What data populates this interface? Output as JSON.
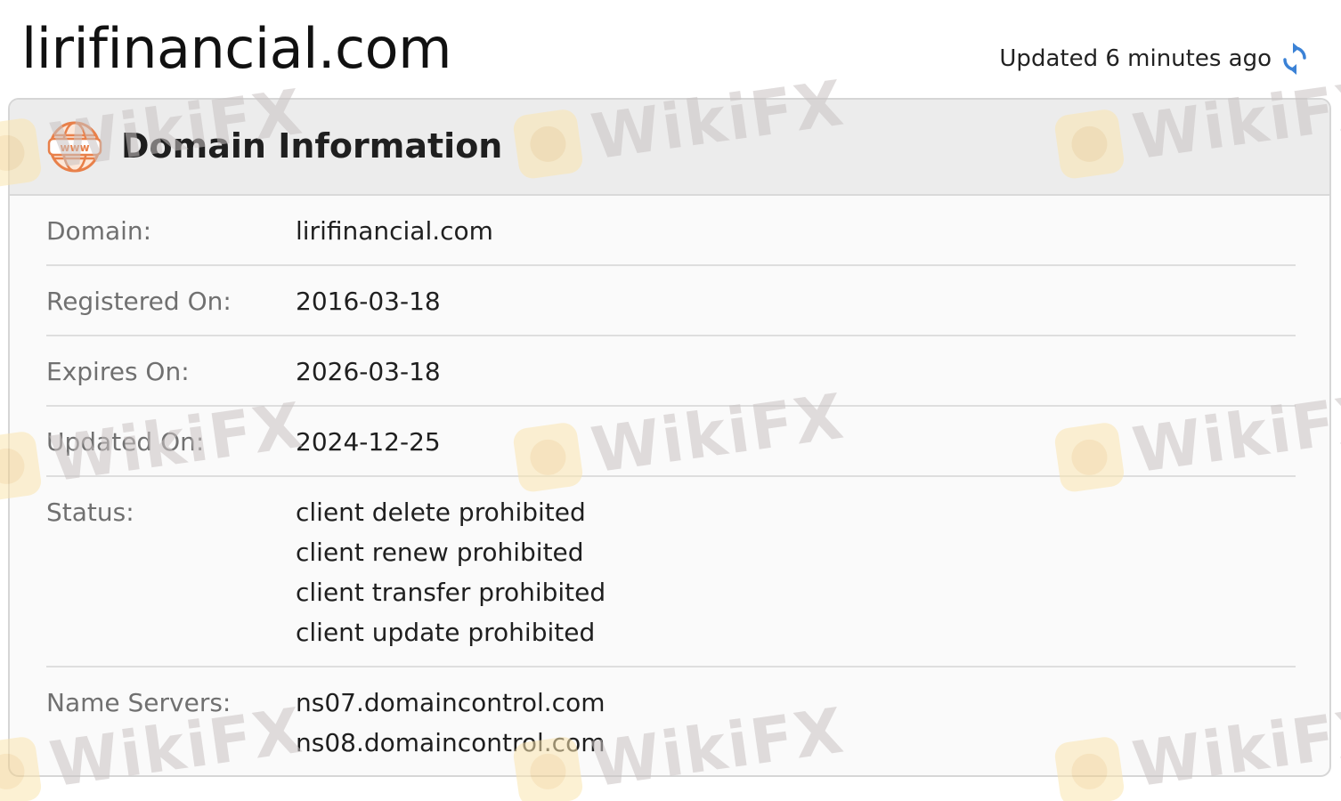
{
  "header": {
    "site_title": "lirifinancial.com",
    "updated_text": "Updated 6 minutes ago"
  },
  "card": {
    "title": "Domain Information",
    "icon": "www-icon",
    "rows": [
      {
        "label": "Domain:",
        "values": [
          "lirifinancial.com"
        ]
      },
      {
        "label": "Registered On:",
        "values": [
          "2016-03-18"
        ]
      },
      {
        "label": "Expires On:",
        "values": [
          "2026-03-18"
        ]
      },
      {
        "label": "Updated On:",
        "values": [
          "2024-12-25"
        ]
      },
      {
        "label": "Status:",
        "values": [
          "client delete prohibited",
          "client renew prohibited",
          "client transfer prohibited",
          "client update prohibited"
        ]
      },
      {
        "label": "Name Servers:",
        "values": [
          "ns07.domaincontrol.com",
          "ns08.domaincontrol.com"
        ]
      }
    ]
  },
  "watermark": {
    "text": "WikiFX"
  },
  "colors": {
    "accent_icon": "#e8804a",
    "refresh_icon": "#3b82d6"
  }
}
